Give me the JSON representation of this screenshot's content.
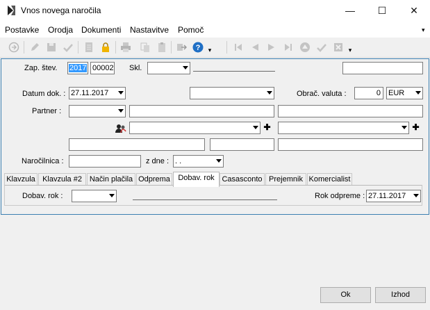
{
  "window": {
    "title": "Vnos novega naročila",
    "controls": {
      "minimize": "—",
      "maximize": "☐",
      "close": "✕"
    }
  },
  "menu": {
    "items": [
      "Postavke",
      "Orodja",
      "Dokumenti",
      "Nastavitve",
      "Pomoč"
    ],
    "overflow": "▾"
  },
  "toolbar": {
    "icons": [
      "circle-arrow-icon",
      "pencil-icon",
      "save-icon",
      "check-icon",
      "document-icon",
      "lock-icon",
      "print-icon",
      "copy-icon",
      "paste-icon",
      "export-icon",
      "help-icon",
      "first-icon",
      "prev-icon",
      "next-icon",
      "last-icon",
      "up-icon",
      "confirm-icon",
      "cancel-icon"
    ],
    "overflow": "▾"
  },
  "form": {
    "zap_stev": {
      "label": "Zap. štev.",
      "year": "2017",
      "number": "00002"
    },
    "skl": {
      "label": "Skl.",
      "value": ""
    },
    "datum_dok": {
      "label": "Datum dok. :",
      "value": "27.11.2017"
    },
    "obrac_valuta": {
      "label": "Obrač. valuta :",
      "amount": "0",
      "currency": "EUR"
    },
    "partner": {
      "label": "Partner :",
      "value": ""
    },
    "narocilnica": {
      "label": "Naročilnica :",
      "value": ""
    },
    "z_dne": {
      "label": "z dne :",
      "value": " .  ."
    },
    "plus_symbol": "✚"
  },
  "tabs": [
    {
      "label": "Klavzula",
      "active": false
    },
    {
      "label": "Klavzula #2",
      "active": false
    },
    {
      "label": "Način plačila",
      "active": false
    },
    {
      "label": "Odprema",
      "active": false
    },
    {
      "label": "Dobav. rok",
      "active": true
    },
    {
      "label": "Casasconto",
      "active": false
    },
    {
      "label": "Prejemnik",
      "active": false
    },
    {
      "label": "Komercialist",
      "active": false
    }
  ],
  "tab_panel": {
    "dobav_rok": {
      "label": "Dobav. rok :",
      "value": ""
    },
    "rok_odpreme": {
      "label": "Rok odpreme :",
      "value": "27.11.2017"
    }
  },
  "buttons": {
    "ok": "Ok",
    "izhod": "Izhod"
  }
}
